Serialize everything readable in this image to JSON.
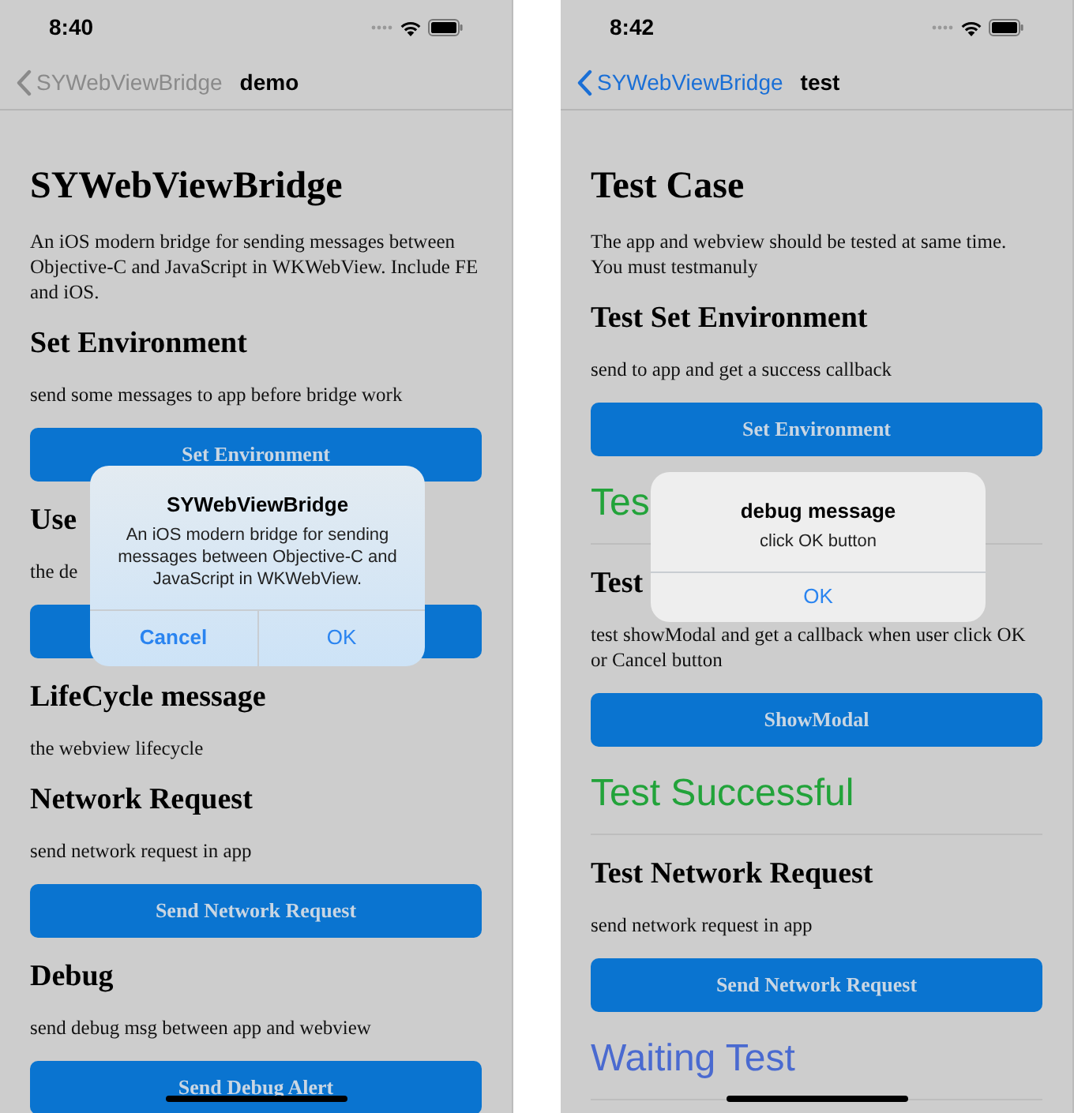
{
  "phones": [
    {
      "status_bar": {
        "time": "8:40"
      },
      "nav": {
        "back_label": "SYWebViewBridge",
        "back_dimmed": true,
        "title": "demo"
      },
      "content": [
        {
          "kind": "h1",
          "text": "SYWebViewBridge"
        },
        {
          "kind": "p",
          "text": "An iOS modern bridge for sending messages between Objective-C and JavaScript in WKWebView. Include FE and iOS."
        },
        {
          "kind": "h2",
          "text": "Set Environment"
        },
        {
          "kind": "p",
          "text": "send some messages to app before bridge work"
        },
        {
          "kind": "button",
          "text": "Set Environment"
        },
        {
          "kind": "h2",
          "text": "Use"
        },
        {
          "kind": "p",
          "text": "the de"
        },
        {
          "kind": "button"
        },
        {
          "kind": "h2",
          "text": "LifeCycle message"
        },
        {
          "kind": "p",
          "text": "the webview lifecycle"
        },
        {
          "kind": "h2",
          "text": "Network Request"
        },
        {
          "kind": "p",
          "text": "send network request in app"
        },
        {
          "kind": "button",
          "text": "Send Network Request"
        },
        {
          "kind": "h2",
          "text": "Debug"
        },
        {
          "kind": "p",
          "text": "send debug msg between app and webview"
        },
        {
          "kind": "button",
          "text": "Send Debug Alert"
        }
      ],
      "dialog": {
        "title": "SYWebViewBridge",
        "message": "An iOS modern bridge for sending messages between Objective-C and JavaScript in WKWebView.",
        "tinted": true,
        "buttons": [
          "Cancel",
          "OK"
        ]
      }
    },
    {
      "status_bar": {
        "time": "8:42"
      },
      "nav": {
        "back_label": "SYWebViewBridge",
        "back_dimmed": false,
        "title": "test"
      },
      "content": [
        {
          "kind": "h1",
          "text": "Test Case"
        },
        {
          "kind": "p",
          "text": "The app and webview should be tested at same time. You must testmanuly"
        },
        {
          "kind": "h2",
          "text": "Test Set Environment"
        },
        {
          "kind": "p",
          "text": "send to app and get a success callback"
        },
        {
          "kind": "button",
          "text": "Set Environment"
        },
        {
          "kind": "status",
          "text": "Tes",
          "color": "#22a33a"
        },
        {
          "kind": "h2",
          "text": "Test"
        },
        {
          "kind": "p",
          "text": "test showModal and get a callback when user click OK or Cancel button"
        },
        {
          "kind": "button",
          "text": "ShowModal"
        },
        {
          "kind": "status",
          "text": "Test Successful",
          "color": "#22a33a"
        },
        {
          "kind": "h2",
          "text": "Test Network Request"
        },
        {
          "kind": "p",
          "text": "send network request in app"
        },
        {
          "kind": "button",
          "text": "Send Network Request"
        },
        {
          "kind": "status",
          "text": "Waiting Test",
          "color": "#4a6ad0"
        }
      ],
      "dialog": {
        "title": "debug message",
        "message": "click OK button",
        "tinted": false,
        "buttons": [
          "OK"
        ]
      }
    }
  ]
}
